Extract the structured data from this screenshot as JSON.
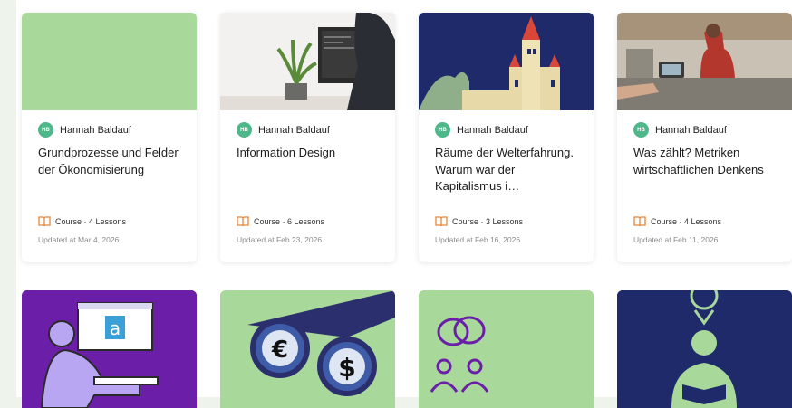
{
  "courses": [
    {
      "author": "Hannah Baldauf",
      "initials": "HB",
      "title": "Grundprozesse und Felder der Ökonomisierung",
      "meta": "Course · 4 Lessons",
      "updated": "Updated at Mar 4, 2026"
    },
    {
      "author": "Hannah Baldauf",
      "initials": "HB",
      "title": "Information Design",
      "meta": "Course · 6 Lessons",
      "updated": "Updated at Feb 23, 2026"
    },
    {
      "author": "Hannah Baldauf",
      "initials": "HB",
      "title": "Räume der Welterfahrung. Warum war der Kapitalismus i…",
      "meta": "Course · 3 Lessons",
      "updated": "Updated at Feb 16, 2026"
    },
    {
      "author": "Hannah Baldauf",
      "initials": "HB",
      "title": "Was zählt? Metriken wirtschaftlichen Denkens",
      "meta": "Course · 4 Lessons",
      "updated": "Updated at Feb 11, 2026"
    }
  ],
  "bottom_cards": [
    {
      "icon_text": "a"
    },
    {
      "euro": "€",
      "dollar": "$"
    },
    {},
    {}
  ],
  "colors": {
    "accent_green": "#a8d99a",
    "navy": "#1f2a6b",
    "purple": "#6b1fa8",
    "avatar": "#4fb88a",
    "book": "#e8873a"
  }
}
